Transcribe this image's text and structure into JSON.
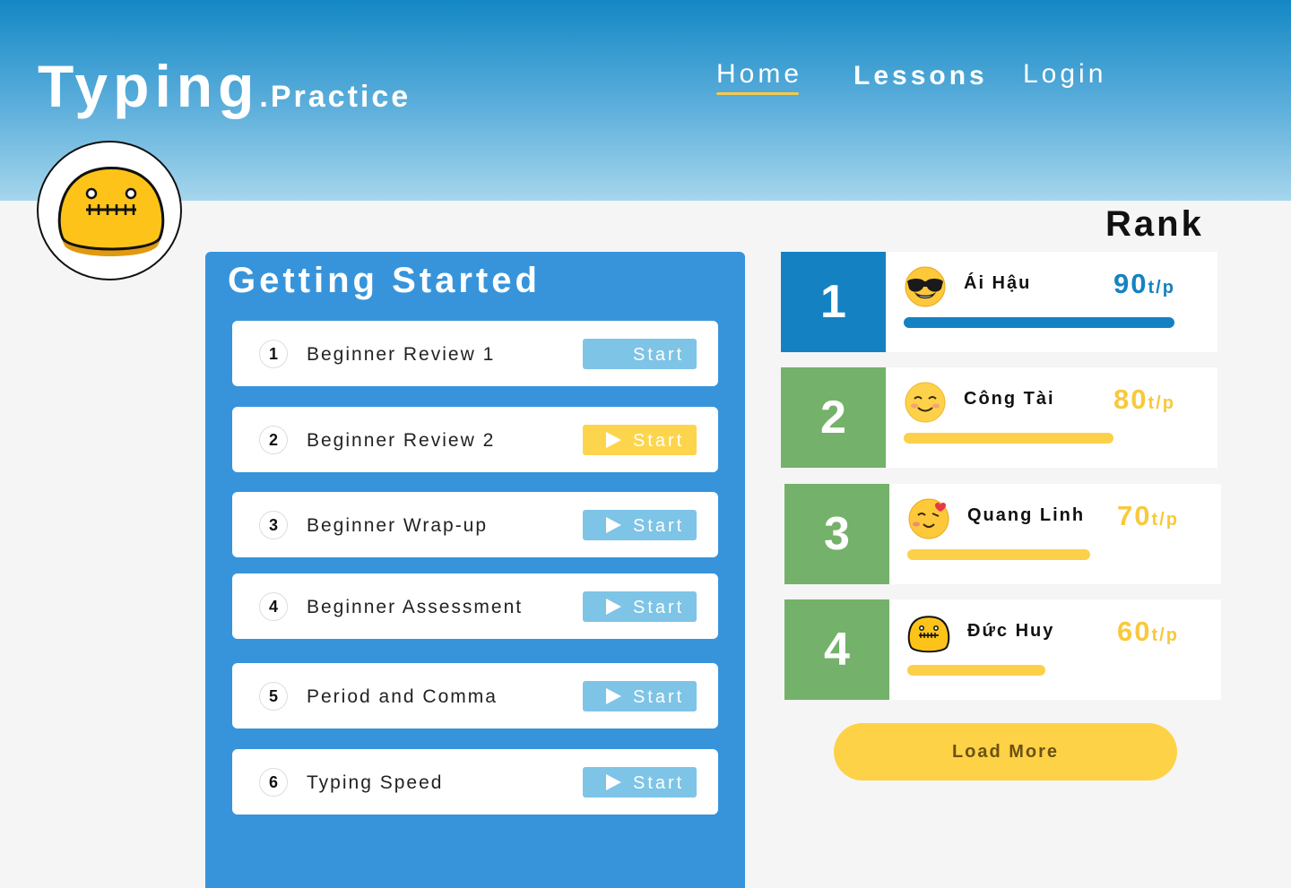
{
  "app": {
    "logo_main": "Typing",
    "logo_sub": ".Practice"
  },
  "nav": {
    "home": "Home",
    "lessons": "Lessons",
    "login": "Login"
  },
  "colors": {
    "header_top": "#1488c4",
    "panel": "#3794db",
    "start_button": "#7ec4e6",
    "start_button_active": "#fdd54c",
    "rank1": "#1482c2",
    "rank_other": "#74b16a",
    "accent_yellow": "#f8c93b"
  },
  "lessons_panel": {
    "title": "Getting Started",
    "items": [
      {
        "num": "1",
        "name": "Beginner Review 1",
        "button": "Start",
        "state": "disabled",
        "show_play_icon": false
      },
      {
        "num": "2",
        "name": "Beginner Review 2",
        "button": "Start",
        "state": "active",
        "show_play_icon": true
      },
      {
        "num": "3",
        "name": "Beginner Wrap-up",
        "button": "Start",
        "state": "normal",
        "show_play_icon": true
      },
      {
        "num": "4",
        "name": "Beginner Assessment",
        "button": "Start",
        "state": "normal",
        "show_play_icon": true
      },
      {
        "num": "5",
        "name": "Period and Comma",
        "button": "Start",
        "state": "normal",
        "show_play_icon": true
      },
      {
        "num": "6",
        "name": "Typing Speed",
        "button": "Start",
        "state": "normal",
        "show_play_icon": true
      }
    ]
  },
  "rank": {
    "title": "Rank",
    "entries": [
      {
        "position": "1",
        "name": "Ái Hậu",
        "score": "90",
        "unit": "t/p",
        "emoji": "sunglasses-emoji",
        "progress": 0.9
      },
      {
        "position": "2",
        "name": "Công Tài",
        "score": "80",
        "unit": "t/p",
        "emoji": "blush-emoji",
        "progress": 0.7
      },
      {
        "position": "3",
        "name": "Quang Linh",
        "score": "70",
        "unit": "t/p",
        "emoji": "kissing-emoji",
        "progress": 0.61
      },
      {
        "position": "4",
        "name": "Đức Huy",
        "score": "60",
        "unit": "t/p",
        "emoji": "zipper-mouth-emoji",
        "progress": 0.46
      }
    ],
    "load_more": "Load More"
  }
}
